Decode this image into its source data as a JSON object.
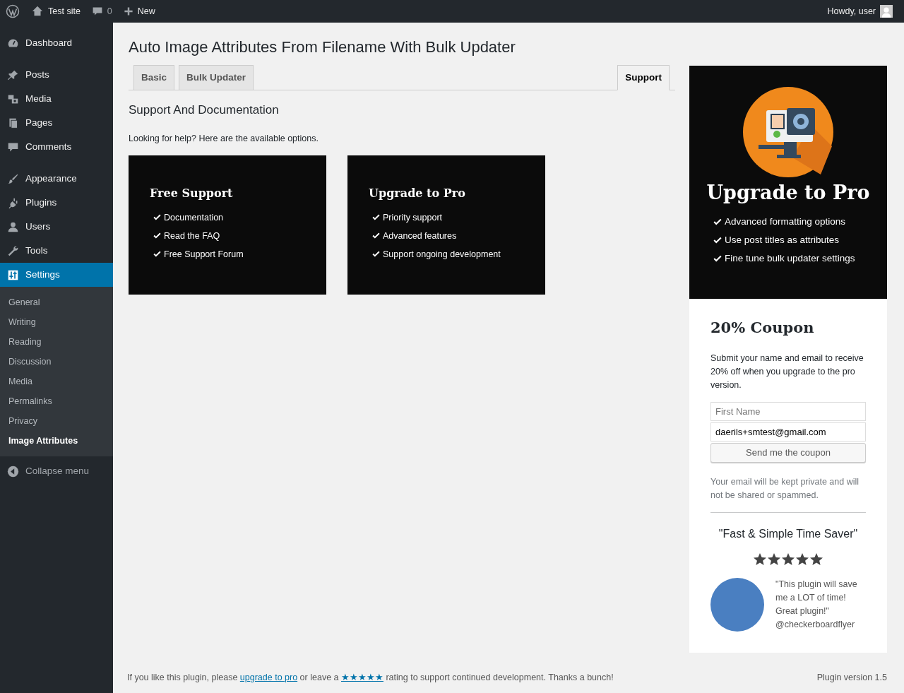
{
  "admin_bar": {
    "site_name": "Test site",
    "comments_count": "0",
    "new_label": "New",
    "greeting": "Howdy, user"
  },
  "sidebar": {
    "items": [
      {
        "label": "Dashboard",
        "kind": "dashboard",
        "selected": false
      },
      {
        "label": "Posts",
        "kind": "posts",
        "selected": false
      },
      {
        "label": "Media",
        "kind": "media",
        "selected": false
      },
      {
        "label": "Pages",
        "kind": "pages",
        "selected": false
      },
      {
        "label": "Comments",
        "kind": "comments",
        "selected": false
      },
      {
        "label": "Appearance",
        "kind": "appearance",
        "selected": false
      },
      {
        "label": "Plugins",
        "kind": "plugins",
        "selected": false
      },
      {
        "label": "Users",
        "kind": "users",
        "selected": false
      },
      {
        "label": "Tools",
        "kind": "tools",
        "selected": false
      },
      {
        "label": "Settings",
        "kind": "settings",
        "selected": true,
        "children": [
          {
            "label": "General",
            "selected": false
          },
          {
            "label": "Writing",
            "selected": false
          },
          {
            "label": "Reading",
            "selected": false
          },
          {
            "label": "Discussion",
            "selected": false
          },
          {
            "label": "Media",
            "selected": false
          },
          {
            "label": "Permalinks",
            "selected": false
          },
          {
            "label": "Privacy",
            "selected": false
          },
          {
            "label": "Image Attributes",
            "selected": true
          }
        ]
      }
    ],
    "collapse_label": "Collapse menu"
  },
  "page_title": "Auto Image Attributes From Filename With Bulk Updater",
  "tabs": [
    {
      "label": "Basic",
      "selected": false
    },
    {
      "label": "Bulk Updater",
      "selected": false
    },
    {
      "label": "Support",
      "selected": true
    }
  ],
  "section_title": "Support And Documentation",
  "intro": "Looking for help? Here are the available options.",
  "boxes": [
    {
      "title": "Free Support",
      "items": [
        "Documentation",
        "Read the FAQ",
        "Free Support Forum"
      ]
    },
    {
      "title": "Upgrade to Pro",
      "items": [
        "Priority support",
        "Advanced features",
        "Support ongoing development"
      ]
    }
  ],
  "promo": {
    "title": "Upgrade to Pro",
    "features": [
      "Advanced formatting options",
      "Use post titles as attributes",
      "Fine tune bulk updater settings"
    ]
  },
  "coupon": {
    "title": "20% Coupon",
    "text": "Submit your name and email to receive 20% off when you upgrade to the pro version.",
    "name_field": {
      "placeholder": "First Name"
    },
    "email_field": {
      "value": "daerils+smtest@gmail.com"
    },
    "button": "Send me the coupon",
    "note": "Your email will be kept private and will not be shared or spammed."
  },
  "testimonial": {
    "title": "\"Fast & Simple Time Saver\"",
    "stars": 5,
    "quote": "\"This plugin will save me a LOT of time! Great plugin!\"",
    "author": "@checkerboardflyer"
  },
  "footer": {
    "text_before": "If you like this plugin, please ",
    "link_upgrade": "upgrade to pro",
    "text_middle": " or leave a ",
    "link_rating": "★★★★★",
    "text_after": " rating to support continued development. Thanks a bunch!",
    "version": "Plugin version 1.5"
  }
}
